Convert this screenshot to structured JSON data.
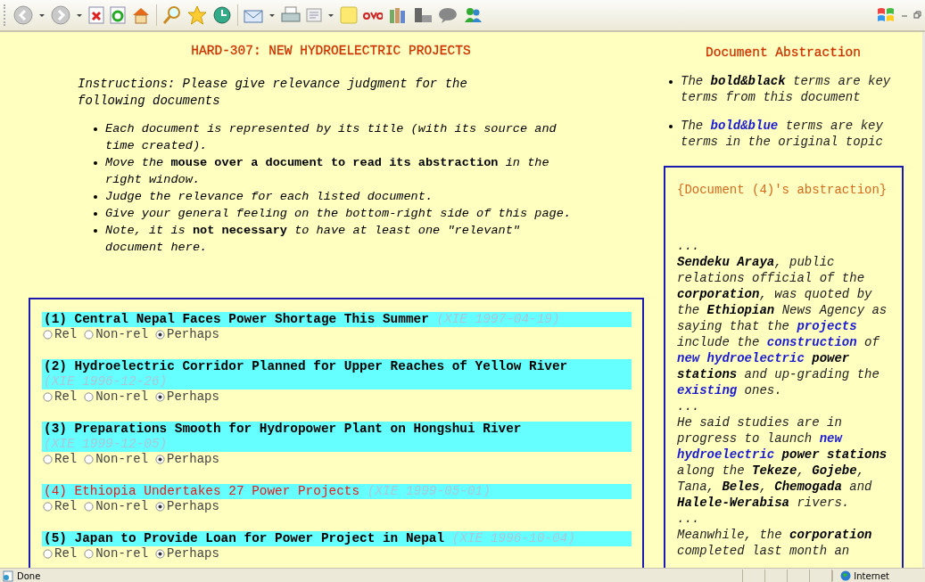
{
  "page": {
    "title": "HARD-307: NEW HYDROELECTRIC PROJECTS",
    "instructions": "Instructions: Please give relevance judgment for the following documents",
    "bullets": [
      "Each document is represented by its title (with its source and time created).",
      "Move the **mouse over a document to read its abstraction** in the right window.",
      "Judge the relevance for each listed document.",
      "Give your general feeling on the bottom-right side of this page.",
      "Note, it is **not necessary** to have at least one \"relevant\" document here."
    ]
  },
  "documents": [
    {
      "title": "(1) Central Nepal Faces Power Shortage This Summer",
      "source": "(XIE 1997-04-19)",
      "selected": false,
      "options": [
        {
          "label": "Rel",
          "selected": false
        },
        {
          "label": "Non-rel",
          "selected": false
        },
        {
          "label": "Perhaps",
          "selected": true
        }
      ]
    },
    {
      "title": "(2) Hydroelectric Corridor Planned for Upper Reaches of Yellow River",
      "source": "(XIE 1996-12-26)",
      "selected": false,
      "options": [
        {
          "label": "Rel",
          "selected": false
        },
        {
          "label": "Non-rel",
          "selected": false
        },
        {
          "label": "Perhaps",
          "selected": true
        }
      ]
    },
    {
      "title": "(3) Preparations Smooth for Hydropower Plant on Hongshui River",
      "source": "(XIE 1999-12-05)",
      "selected": false,
      "options": [
        {
          "label": "Rel",
          "selected": false
        },
        {
          "label": "Non-rel",
          "selected": false
        },
        {
          "label": "Perhaps",
          "selected": true
        }
      ]
    },
    {
      "title": "(4) Ethiopia Undertakes 27 Power Projects",
      "source": "(XIE 1999-05-01)",
      "selected": true,
      "options": [
        {
          "label": "Rel",
          "selected": false
        },
        {
          "label": "Non-rel",
          "selected": false
        },
        {
          "label": "Perhaps",
          "selected": true
        }
      ]
    },
    {
      "title": "(5) Japan to Provide Loan for Power Project in Nepal",
      "source": "(XIE 1996-10-04)",
      "selected": false,
      "options": [
        {
          "label": "Rel",
          "selected": false
        },
        {
          "label": "Non-rel",
          "selected": false
        },
        {
          "label": "Perhaps",
          "selected": true
        }
      ]
    }
  ],
  "abstraction": {
    "title": "Document Abstraction",
    "legend": [
      [
        {
          "text": "The ",
          "kind": "plain"
        },
        {
          "text": "bold&black",
          "kind": "key"
        },
        {
          "text": " terms are key terms from this document",
          "kind": "plain"
        }
      ],
      [
        {
          "text": "The ",
          "kind": "plain"
        },
        {
          "text": "bold&blue",
          "kind": "topic"
        },
        {
          "text": " terms are key terms in the original topic",
          "kind": "plain"
        }
      ]
    ],
    "heading": "{Document (4)'s abstraction}",
    "paragraphs": [
      [
        {
          "text": "...",
          "kind": "plain"
        }
      ],
      [
        {
          "text": "Sendeku Araya",
          "kind": "key"
        },
        {
          "text": ", public relations official of the ",
          "kind": "plain"
        },
        {
          "text": "corporation",
          "kind": "key"
        },
        {
          "text": ", was quoted by the ",
          "kind": "plain"
        },
        {
          "text": "Ethiopian",
          "kind": "key"
        },
        {
          "text": " News Agency as saying that the ",
          "kind": "plain"
        },
        {
          "text": "projects",
          "kind": "topic"
        },
        {
          "text": " include the ",
          "kind": "plain"
        },
        {
          "text": "construction",
          "kind": "topic"
        },
        {
          "text": " of ",
          "kind": "plain"
        },
        {
          "text": "new hydroelectric",
          "kind": "topic"
        },
        {
          "text": " power stations",
          "kind": "key"
        },
        {
          "text": " and up-grading the ",
          "kind": "plain"
        },
        {
          "text": "existing",
          "kind": "topic"
        },
        {
          "text": " ones.",
          "kind": "plain"
        }
      ],
      [
        {
          "text": "...",
          "kind": "plain"
        }
      ],
      [
        {
          "text": "He said studies are in progress to launch ",
          "kind": "plain"
        },
        {
          "text": "new hydroelectric",
          "kind": "topic"
        },
        {
          "text": " power stations",
          "kind": "key"
        },
        {
          "text": " along the ",
          "kind": "plain"
        },
        {
          "text": "Tekeze",
          "kind": "key"
        },
        {
          "text": ", ",
          "kind": "plain"
        },
        {
          "text": "Gojebe",
          "kind": "key"
        },
        {
          "text": ", Tana, ",
          "kind": "plain"
        },
        {
          "text": "Beles",
          "kind": "key"
        },
        {
          "text": ", ",
          "kind": "plain"
        },
        {
          "text": "Chemogada",
          "kind": "key"
        },
        {
          "text": " and ",
          "kind": "plain"
        },
        {
          "text": "Halele-Werabisa",
          "kind": "key"
        },
        {
          "text": " rivers.",
          "kind": "plain"
        }
      ],
      [
        {
          "text": "...",
          "kind": "plain"
        }
      ],
      [
        {
          "text": "Meanwhile, the ",
          "kind": "plain"
        },
        {
          "text": "corporation",
          "kind": "key"
        },
        {
          "text": " completed last month an",
          "kind": "plain"
        }
      ]
    ]
  },
  "status_bar": {
    "status": "Done",
    "zone": "Internet"
  }
}
